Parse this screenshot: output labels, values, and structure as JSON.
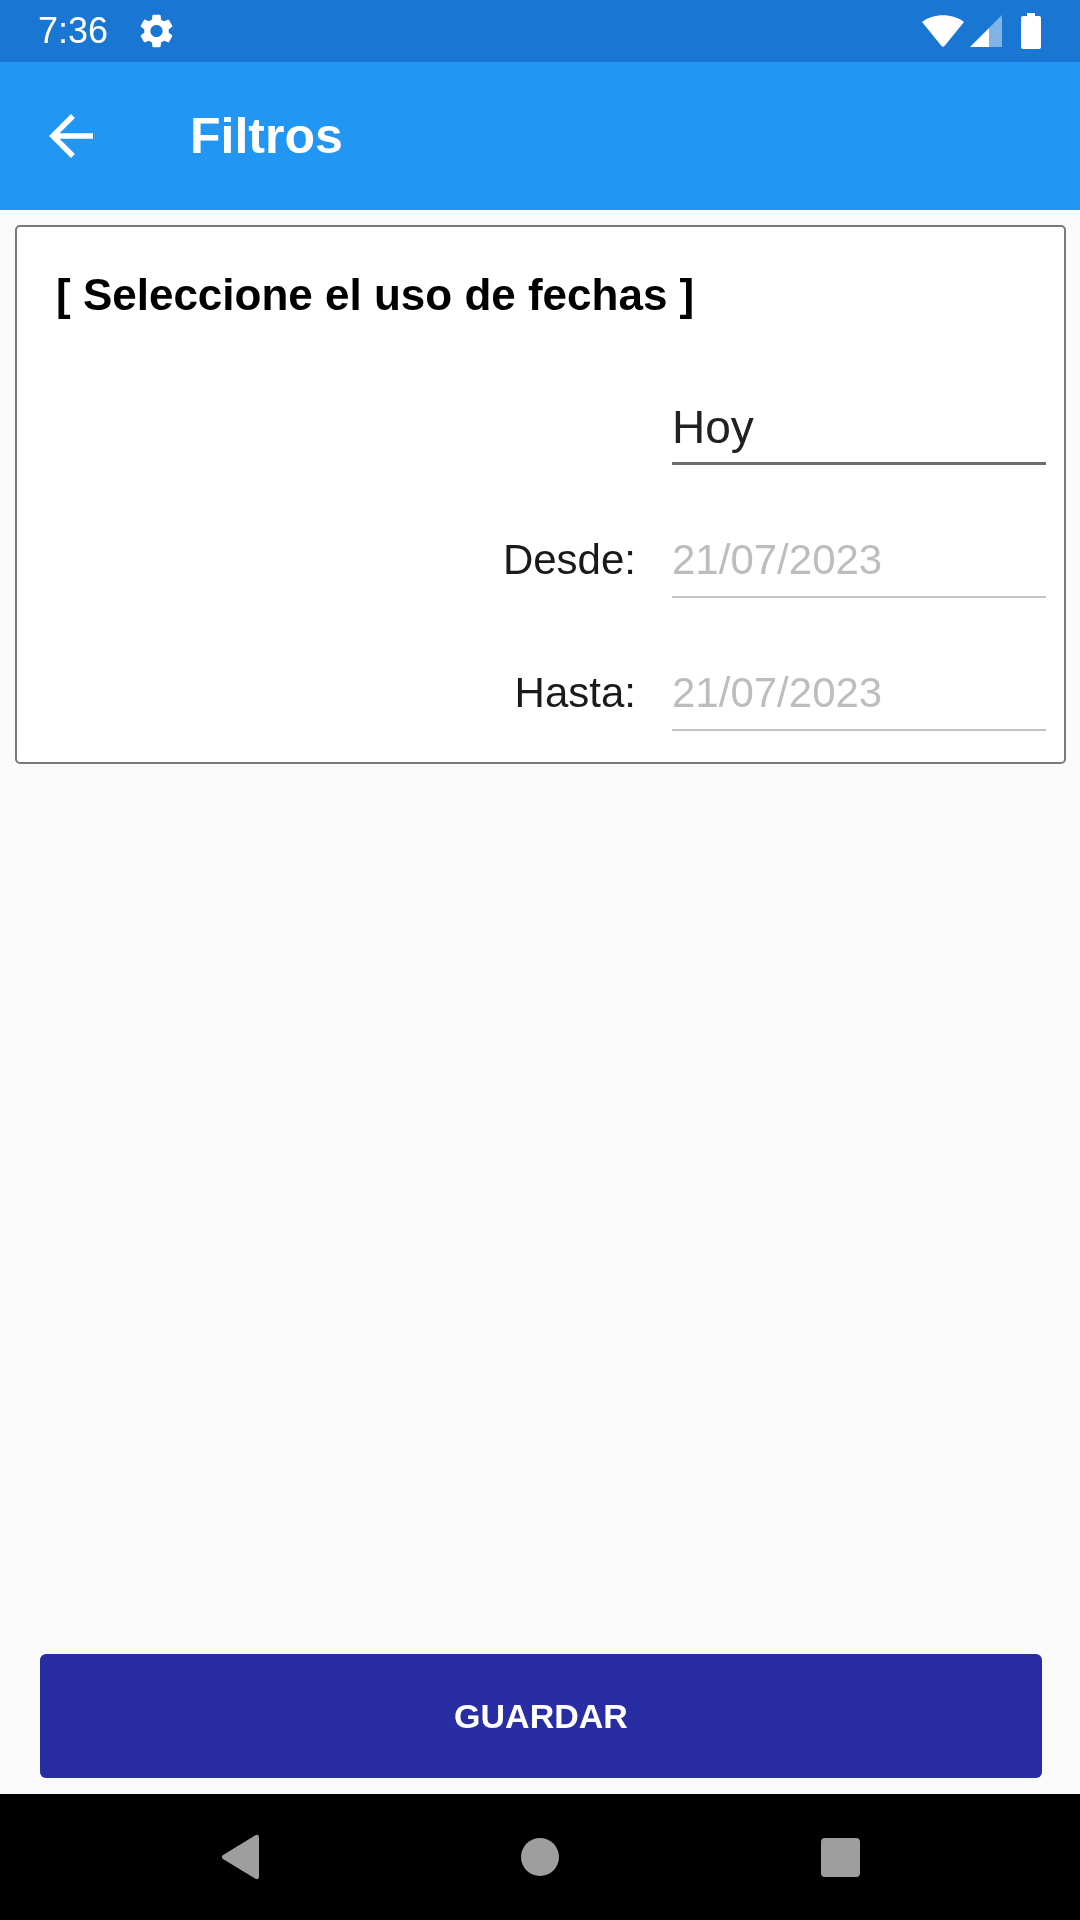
{
  "status_bar": {
    "time": "7:36"
  },
  "app_bar": {
    "title": "Filtros"
  },
  "card": {
    "heading": "[ Seleccione el uso de fechas ]",
    "fields": [
      {
        "kind": "picker",
        "value": "Hoy",
        "disabled": false
      },
      {
        "kind": "date",
        "label": "Desde:",
        "value": "21/07/2023",
        "disabled": true
      },
      {
        "kind": "date",
        "label": "Hasta:",
        "value": "21/07/2023",
        "disabled": true
      }
    ]
  },
  "button": {
    "label": "GUARDAR"
  }
}
